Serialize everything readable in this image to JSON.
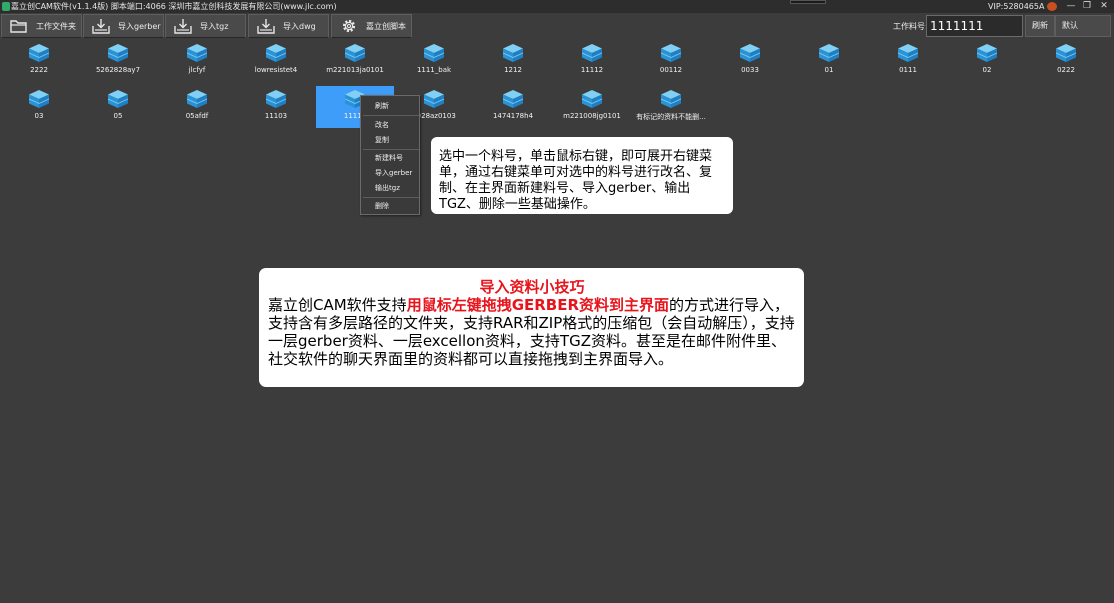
{
  "window": {
    "title": "嘉立创CAM软件(v1.1.4版) 脚本端口:4066 深圳市嘉立创科技发展有限公司(www.jlc.com)",
    "vip": "VIP:5280465A",
    "minimize_glyph": "—",
    "restore_glyph": "❐",
    "close_glyph": "✕"
  },
  "toolbar": {
    "buttons": [
      {
        "label": "工作文件夹",
        "icon": "folder-icon"
      },
      {
        "label": "导入gerber",
        "icon": "import-tray-icon"
      },
      {
        "label": "导入tgz",
        "icon": "import-tray-icon"
      },
      {
        "label": "导入dwg",
        "icon": "import-tray-icon"
      },
      {
        "label": "嘉立创脚本",
        "icon": "gear-icon"
      }
    ],
    "part_label": "工作料号:",
    "part_value": "1111111",
    "refresh_label": "刷新",
    "default_label": "默认"
  },
  "items_row1": [
    "2222",
    "5262828ay7",
    "jlcfyf",
    "lowresistet4",
    "m221013ja0101",
    "1111_bak",
    "1212",
    "11112",
    "00112",
    "0033",
    "01",
    "0111",
    "02",
    "0222"
  ],
  "items_row2": [
    "03",
    "05",
    "05afdf",
    "11103",
    "11111",
    "0928az0103",
    "1474178h4",
    "m221008jg0101",
    "有标记的资料不能删..."
  ],
  "context_menu": {
    "items": [
      "刷新",
      "改名",
      "复制",
      "新建料号",
      "导入gerber",
      "输出tgz",
      "删除"
    ]
  },
  "callout1": {
    "text": "选中一个料号，单击鼠标右键，即可展开右键菜单，通过右键菜单可对选中的料号进行改名、复制、在主界面新建料号、导入gerber、输出TGZ、删除一些基础操作。"
  },
  "callout2": {
    "title": "导入资料小技巧",
    "text_before": "嘉立创CAM软件支持",
    "text_highlight": "用鼠标左键拖拽GERBER资料到主界面",
    "text_after": "的方式进行导入，支持含有多层路径的文件夹，支持RAR和ZIP格式的压缩包（会自动解压），支持一层gerber资料、一层excellon资料，支持TGZ资料。甚至是在邮件附件里、社交软件的聊天界面里的资料都可以直接拖拽到主界面导入。"
  },
  "colors": {
    "background": "#3c3c3c",
    "selection": "#3f9dfa",
    "cube_top": "#7fd0f4",
    "cube_side": "#2a93d5",
    "highlight_red": "#e8141c"
  }
}
